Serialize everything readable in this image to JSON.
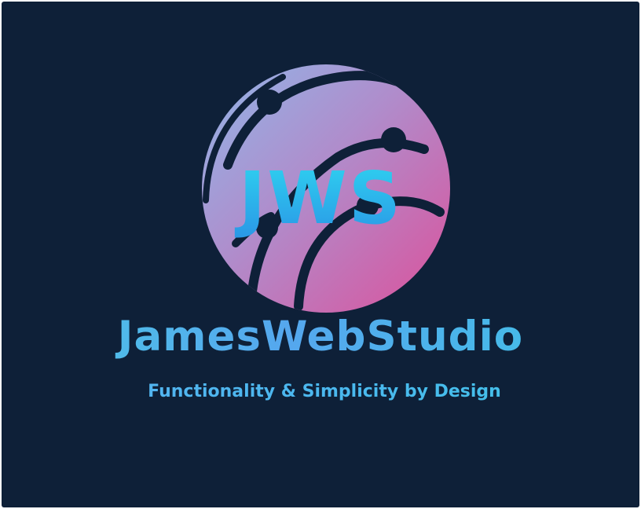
{
  "logo": {
    "monogram": "JWS",
    "icon": "globe-network-icon"
  },
  "brand": {
    "name": "JamesWebStudio",
    "tagline": "Functionality & Simplicity by Design"
  },
  "colors": {
    "background": "#0e2038",
    "globe_top": "#8fb0e6",
    "globe_bottom": "#d8579f",
    "monogram_top": "#2fd0ef",
    "monogram_bottom": "#2aa2e8",
    "text_primary": "#4cc7e6"
  }
}
